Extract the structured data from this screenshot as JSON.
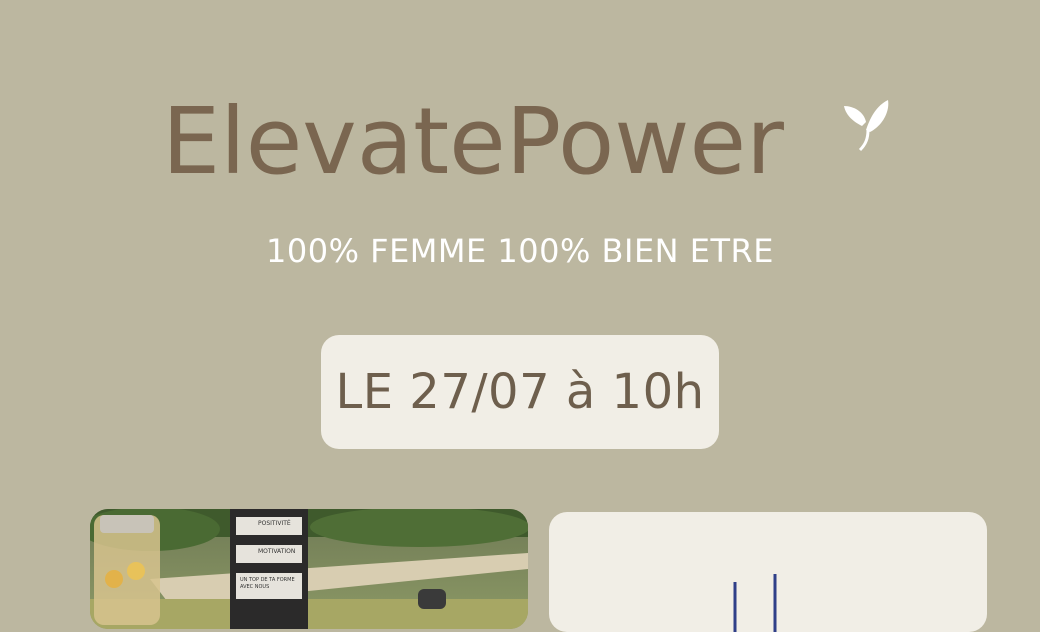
{
  "brand": {
    "name": "ElevatePower",
    "logo_icon": "leaf-icon"
  },
  "tagline": "100% FEMME 100% BIEN ETRE",
  "event": {
    "date_label": "LE 27/07 à 10h"
  },
  "photo": {
    "banner_lines": [
      "POSITIVITÉ",
      "MOTIVATION",
      "UN TOP DE TA FORME AVEC NOUS"
    ]
  },
  "colors": {
    "background": "#bcb7a0",
    "brand_text": "#7a6650",
    "pill_bg": "#f1eee6",
    "pill_text": "#6e5f4d"
  }
}
